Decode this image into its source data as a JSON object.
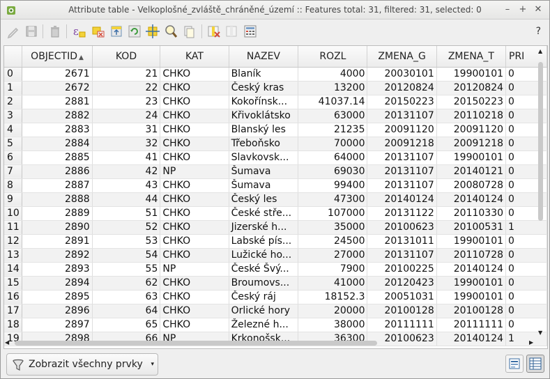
{
  "window": {
    "title": "Attribute table - Velkoplošné_zvláště_chráněné_území :: Features total: 31, filtered: 31, selected: 0",
    "controls": {
      "minimize": "–",
      "maximize": "+",
      "close": "✕"
    }
  },
  "toolbar": {
    "help_label": "?"
  },
  "table": {
    "columns": [
      {
        "label": "OBJECTID",
        "sort": "▲"
      },
      {
        "label": "KOD"
      },
      {
        "label": "KAT"
      },
      {
        "label": "NAZEV"
      },
      {
        "label": "ROZL"
      },
      {
        "label": "ZMENA_G"
      },
      {
        "label": "ZMENA_T"
      },
      {
        "label": "PRI"
      }
    ],
    "rows": [
      {
        "idx": "0",
        "cells": [
          "2671",
          "21",
          "CHKO",
          "Blaník",
          "4000",
          "20030101",
          "19900101",
          "0"
        ]
      },
      {
        "idx": "1",
        "cells": [
          "2672",
          "22",
          "CHKO",
          "Český kras",
          "13200",
          "20120824",
          "20120824",
          "0"
        ]
      },
      {
        "idx": "2",
        "cells": [
          "2881",
          "23",
          "CHKO",
          "Kokořínsk...",
          "41037.14",
          "20150223",
          "20150223",
          "0"
        ]
      },
      {
        "idx": "3",
        "cells": [
          "2882",
          "24",
          "CHKO",
          "Křivoklátsko",
          "63000",
          "20131107",
          "20110218",
          "0"
        ]
      },
      {
        "idx": "4",
        "cells": [
          "2883",
          "31",
          "CHKO",
          "Blanský les",
          "21235",
          "20091120",
          "20091120",
          "0"
        ]
      },
      {
        "idx": "5",
        "cells": [
          "2884",
          "32",
          "CHKO",
          "Třeboňsko",
          "70000",
          "20091218",
          "20091218",
          "0"
        ]
      },
      {
        "idx": "6",
        "cells": [
          "2885",
          "41",
          "CHKO",
          "Slavkovsk...",
          "64000",
          "20131107",
          "19900101",
          "0"
        ]
      },
      {
        "idx": "7",
        "cells": [
          "2886",
          "42",
          "NP",
          "Šumava",
          "69030",
          "20131107",
          "20140121",
          "0"
        ]
      },
      {
        "idx": "8",
        "cells": [
          "2887",
          "43",
          "CHKO",
          "Šumava",
          "99400",
          "20131107",
          "20080728",
          "0"
        ]
      },
      {
        "idx": "9",
        "cells": [
          "2888",
          "44",
          "CHKO",
          "Český les",
          "47300",
          "20140124",
          "20140124",
          "0"
        ]
      },
      {
        "idx": "10",
        "cells": [
          "2889",
          "51",
          "CHKO",
          "České stře...",
          "107000",
          "20131122",
          "20110330",
          "0"
        ]
      },
      {
        "idx": "11",
        "cells": [
          "2890",
          "52",
          "CHKO",
          "Jizerské h...",
          "35000",
          "20100623",
          "20100531",
          "1"
        ]
      },
      {
        "idx": "12",
        "cells": [
          "2891",
          "53",
          "CHKO",
          "Labské pís...",
          "24500",
          "20131011",
          "19900101",
          "0"
        ]
      },
      {
        "idx": "13",
        "cells": [
          "2892",
          "54",
          "CHKO",
          "Lužické ho...",
          "27000",
          "20131107",
          "20110728",
          "0"
        ]
      },
      {
        "idx": "14",
        "cells": [
          "2893",
          "55",
          "NP",
          "České Švý...",
          "7900",
          "20100225",
          "20140124",
          "0"
        ]
      },
      {
        "idx": "15",
        "cells": [
          "2894",
          "62",
          "CHKO",
          "Broumovs...",
          "41000",
          "20120423",
          "19900101",
          "0"
        ]
      },
      {
        "idx": "16",
        "cells": [
          "2895",
          "63",
          "CHKO",
          "Český ráj",
          "18152.3",
          "20051031",
          "19900101",
          "0"
        ]
      },
      {
        "idx": "17",
        "cells": [
          "2896",
          "64",
          "CHKO",
          "Orlické hory",
          "20000",
          "20100128",
          "20100128",
          "0"
        ]
      },
      {
        "idx": "18",
        "cells": [
          "2897",
          "65",
          "CHKO",
          "Železné h...",
          "38000",
          "20111111",
          "20111111",
          "0"
        ]
      },
      {
        "idx": "19",
        "cells": [
          "2898",
          "66",
          "NP",
          "Krkonošsk...",
          "36300",
          "20100623",
          "20140124",
          "1"
        ]
      }
    ]
  },
  "bottom": {
    "filter_label": "Zobrazit všechny prvky",
    "filter_arrow": "▾"
  }
}
